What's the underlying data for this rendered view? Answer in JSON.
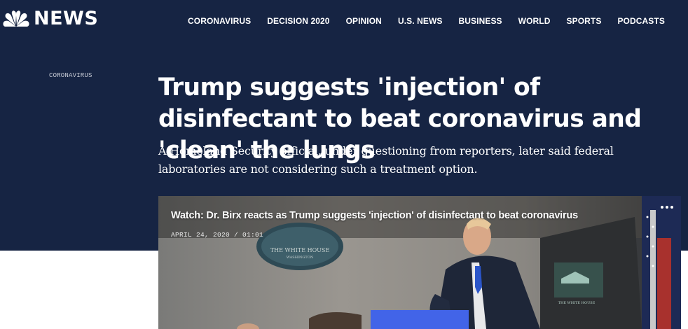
{
  "header": {
    "brand": "NEWS",
    "nav": [
      "CORONAVIRUS",
      "DECISION 2020",
      "OPINION",
      "U.S. NEWS",
      "BUSINESS",
      "WORLD",
      "SPORTS",
      "PODCASTS"
    ]
  },
  "article": {
    "section": "CORONAVIRUS",
    "headline": "Trump suggests 'injection' of disinfectant to beat coronavirus and 'clean' the lungs",
    "dek": "A Homeland Security official, under questioning from reporters, later said federal laboratories are not considering such a treatment option."
  },
  "video": {
    "title": "Watch: Dr. Birx reacts as Trump suggests 'injection' of disinfectant to beat coronavirus",
    "meta": "APRIL 24, 2020 / 01:01",
    "seal_text": "THE WHITE HOUSE",
    "seal_subtext": "WASHINGTON",
    "podium_text": "THE WHITE HOUSE"
  },
  "colors": {
    "hero_bg": "#162443",
    "accent_blue": "#4264e8"
  }
}
